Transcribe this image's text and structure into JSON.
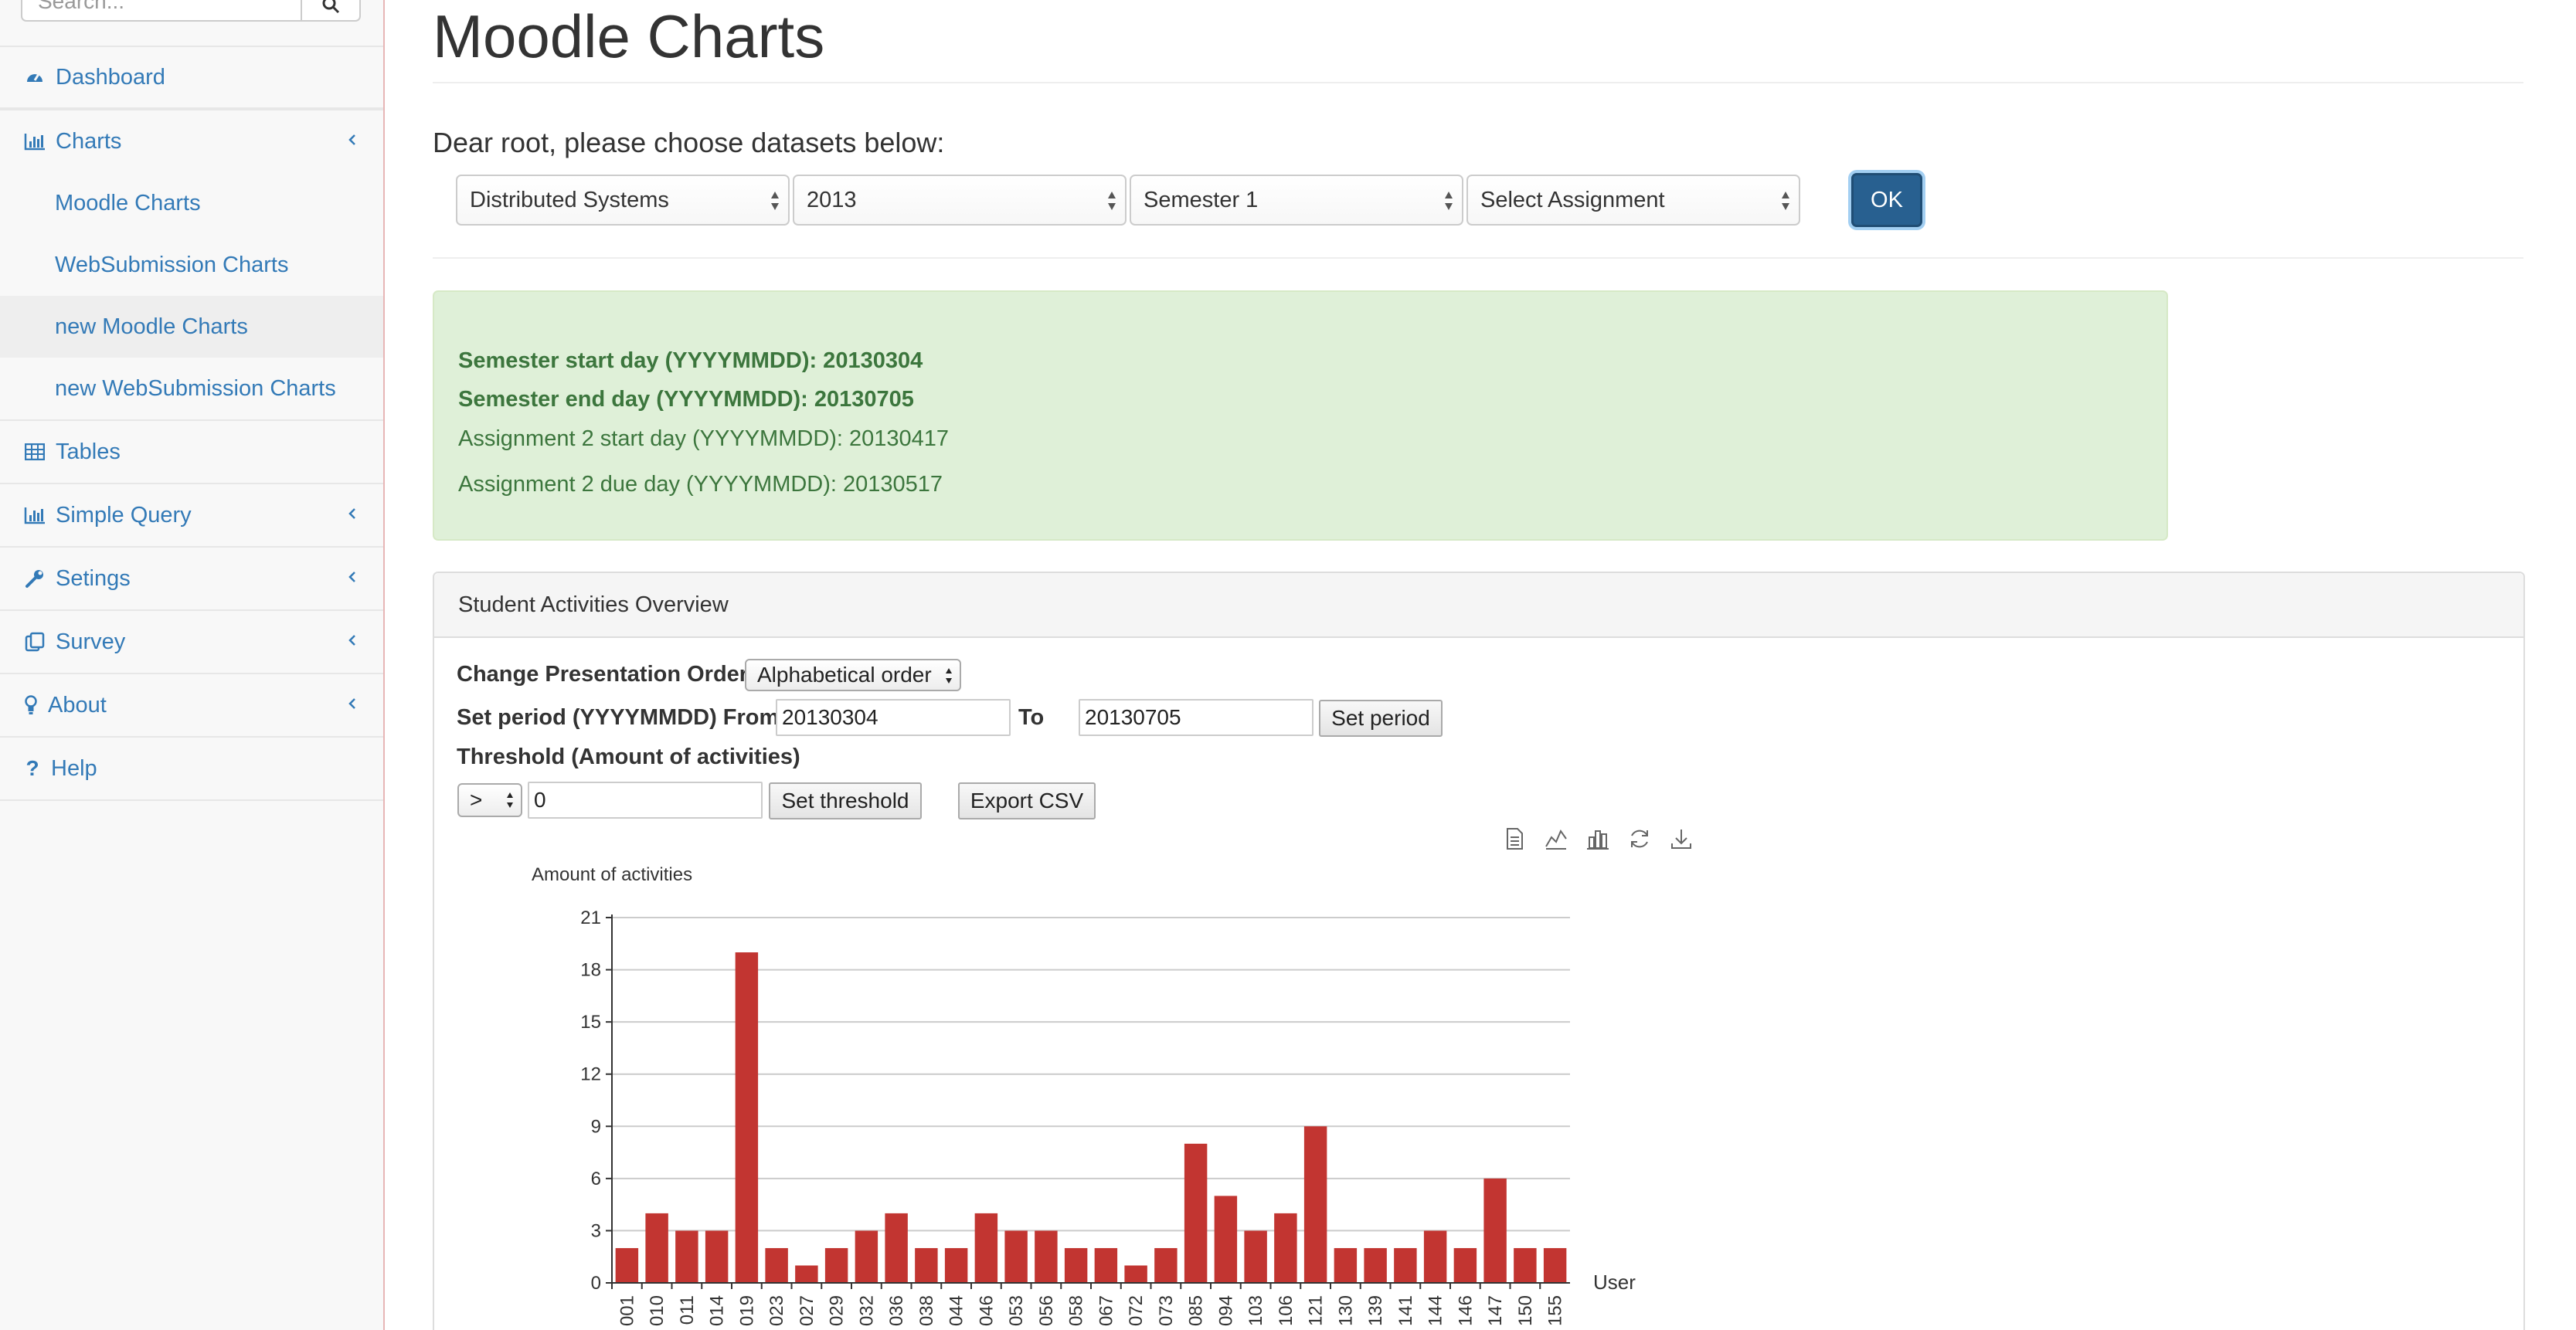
{
  "sidebar": {
    "search_placeholder": "Search...",
    "items": [
      {
        "label": "Dashboard",
        "icon": "dashboard-icon"
      },
      {
        "label": "Charts",
        "icon": "bar-chart-icon",
        "children": [
          {
            "label": "Moodle Charts"
          },
          {
            "label": "WebSubmission Charts"
          },
          {
            "label": "new Moodle Charts",
            "active": true
          },
          {
            "label": "new WebSubmission Charts"
          }
        ]
      },
      {
        "label": "Tables",
        "icon": "table-icon"
      },
      {
        "label": "Simple Query",
        "icon": "bar-chart-icon"
      },
      {
        "label": "Setings",
        "icon": "wrench-icon"
      },
      {
        "label": "Survey",
        "icon": "clipboard-icon"
      },
      {
        "label": "About",
        "icon": "lightbulb-icon"
      },
      {
        "label": "Help",
        "icon": "question-icon"
      }
    ]
  },
  "header": {
    "title": "Moodle Charts",
    "prompt": "Dear root, please choose datasets below:"
  },
  "dataset_selects": [
    "Distributed Systems",
    "2013",
    "Semester 1",
    "Select Assignment"
  ],
  "ok_label": "OK",
  "info": {
    "semester_start": "Semester start day (YYYYMMDD): 20130304",
    "semester_end": "Semester end day (YYYYMMDD): 20130705",
    "assignment_start": "Assignment 2 start day (YYYYMMDD): 20130417",
    "assignment_due": "Assignment 2 due day (YYYYMMDD): 20130517"
  },
  "panel": {
    "title": "Student Activities Overview",
    "order_label": "Change Presentation Order",
    "order_value": "Alphabetical order",
    "period_label": "Set period (YYYYMMDD) From",
    "period_from": "20130304",
    "to_label": "To",
    "period_to": "20130705",
    "set_period_label": "Set period",
    "threshold_label": "Threshold (Amount of activities)",
    "threshold_op": ">",
    "threshold_value": "0",
    "set_threshold_label": "Set threshold",
    "export_label": "Export CSV"
  },
  "colors": {
    "bar": "#c23531",
    "link": "#337ab7",
    "alert_bg": "#dff0d8",
    "alert_text": "#3c763d",
    "ok_button": "#286090"
  },
  "chart_data": {
    "type": "bar",
    "ylabel": "Amount of activities",
    "xlabel": "User",
    "ylim": [
      0,
      21
    ],
    "yticks": [
      0,
      3,
      6,
      9,
      12,
      15,
      18,
      21
    ],
    "grid": true,
    "categories": [
      "001",
      "010",
      "011",
      "014",
      "019",
      "023",
      "027",
      "029",
      "032",
      "036",
      "038",
      "044",
      "046",
      "053",
      "056",
      "058",
      "067",
      "072",
      "073",
      "085",
      "094",
      "103",
      "106",
      "121",
      "130",
      "139",
      "141",
      "144",
      "146",
      "147",
      "150",
      "155"
    ],
    "values": [
      2,
      4,
      3,
      3,
      19,
      2,
      1,
      2,
      3,
      4,
      2,
      2,
      4,
      3,
      3,
      2,
      2,
      1,
      2,
      8,
      5,
      3,
      4,
      9,
      2,
      2,
      2,
      3,
      2,
      6,
      2,
      2
    ]
  }
}
